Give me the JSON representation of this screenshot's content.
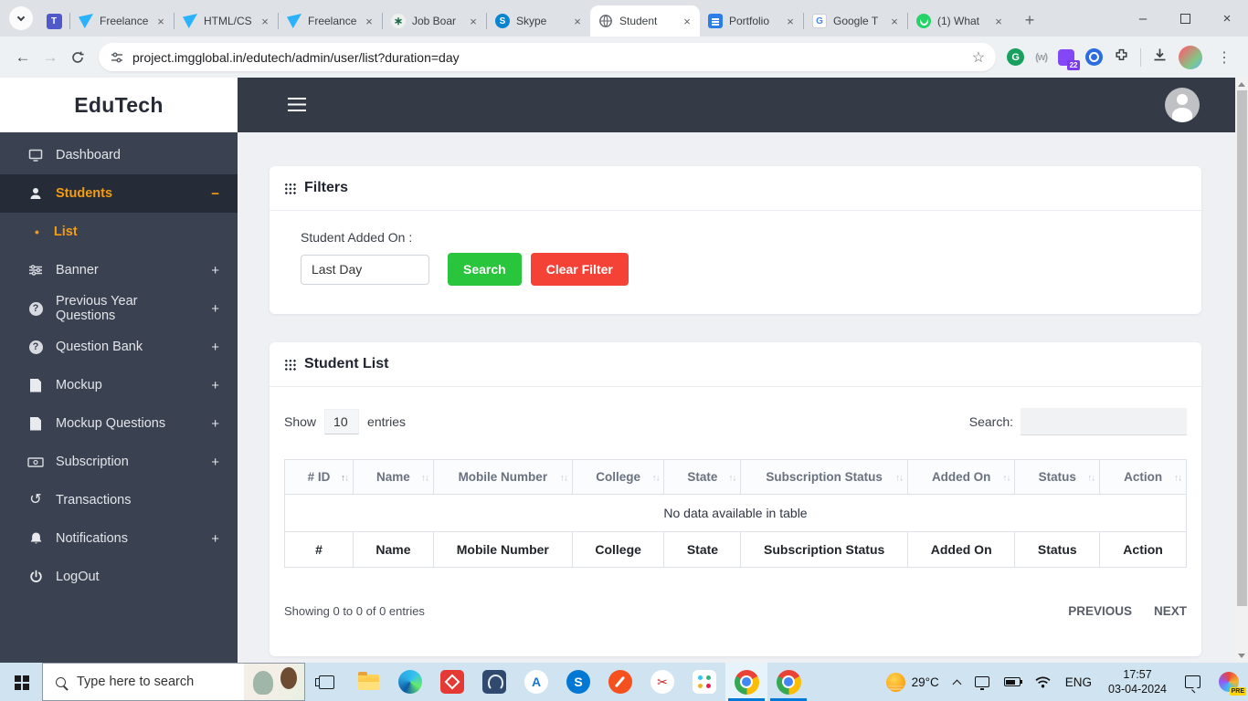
{
  "colors": {
    "accent_orange": "#f39c12",
    "search_button_green": "#28c53d",
    "clear_button_red": "#f44336",
    "sidebar_bg": "#3a4150",
    "topbar_bg": "#343b47",
    "taskbar_bg": "#cfe3f1"
  },
  "icons": {
    "close": "×",
    "minimize": "–",
    "new_tab": "+",
    "back": "←",
    "forward": "→",
    "star": "☆",
    "kebab": "⋮",
    "sort_up": "↑",
    "sort_down": "↓",
    "plus": "+",
    "minus": "−",
    "bullet": "•",
    "history": "↺",
    "question": "?",
    "scissors": "✂",
    "asterisk": "∗",
    "w_ext": "(w)",
    "letter_t": "T",
    "letter_s": "S",
    "letter_g": "G",
    "letter_a": "A"
  },
  "browser": {
    "tabs": [
      {
        "label": "Freelance"
      },
      {
        "label": "HTML/CS"
      },
      {
        "label": "Freelance"
      },
      {
        "label": "Job Boar"
      },
      {
        "label": "Skype"
      },
      {
        "label": "Student"
      },
      {
        "label": "Portfolio"
      },
      {
        "label": "Google T"
      },
      {
        "label": "(1) What"
      }
    ],
    "url": "project.imgglobal.in/edutech/admin/user/list?duration=day",
    "extension_badge": "22"
  },
  "sidebar": {
    "brand": "EduTech",
    "items": [
      {
        "label": "Dashboard"
      },
      {
        "label": "Students",
        "toggle": "−"
      },
      {
        "label": "List"
      },
      {
        "label": "Banner",
        "toggle": "+"
      },
      {
        "label": "Previous Year Questions",
        "toggle": "+"
      },
      {
        "label": "Question Bank",
        "toggle": "+"
      },
      {
        "label": "Mockup",
        "toggle": "+"
      },
      {
        "label": "Mockup Questions",
        "toggle": "+"
      },
      {
        "label": "Subscription",
        "toggle": "+"
      },
      {
        "label": "Transactions"
      },
      {
        "label": "Notifications",
        "toggle": "+"
      },
      {
        "label": "LogOut"
      }
    ]
  },
  "filters": {
    "title": "Filters",
    "label": "Student Added On :",
    "value": "Last Day",
    "search_btn": "Search",
    "clear_btn": "Clear Filter"
  },
  "student_list": {
    "title": "Student List",
    "show_label": "Show",
    "page_size": "10",
    "entries_label": "entries",
    "search_label": "Search:",
    "search_value": "",
    "columns": [
      "# ID",
      "Name",
      "Mobile Number",
      "College",
      "State",
      "Subscription Status",
      "Added On",
      "Status",
      "Action"
    ],
    "footer_columns": [
      "#",
      "Name",
      "Mobile Number",
      "College",
      "State",
      "Subscription Status",
      "Added On",
      "Status",
      "Action"
    ],
    "empty_message": "No data available in table",
    "info": "Showing 0 to 0 of 0 entries",
    "prev": "PREVIOUS",
    "next": "NEXT"
  },
  "taskbar": {
    "search_placeholder": "Type here to search",
    "tray": {
      "temperature": "29°C",
      "language": "ENG",
      "time": "17:57",
      "date": "03-04-2024",
      "copilot_badge": "PRE"
    }
  }
}
